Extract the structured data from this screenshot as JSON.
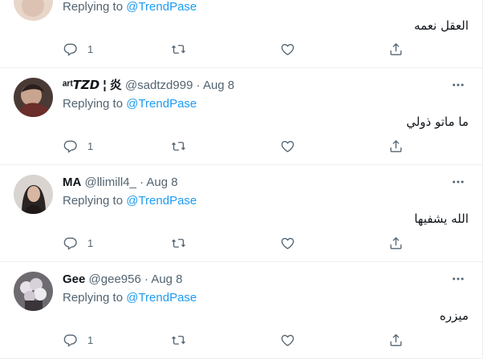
{
  "tweets": [
    {
      "name": "",
      "handle": "",
      "date": "",
      "replying_prefix": "Replying to",
      "replying_to": "@TrendPase",
      "text": "العقل نعمه",
      "reply_count": "1",
      "avatar_color": "#e8d6c9"
    },
    {
      "name": "ᵃʳᵗ𝙏𝙕𝘿 ¦ 炎",
      "handle": "@sadtzd999",
      "date": "Aug 8",
      "replying_prefix": "Replying to",
      "replying_to": "@TrendPase",
      "text": "ما ماتو ذولي",
      "reply_count": "1",
      "avatar_color": "#4a3a36"
    },
    {
      "name": "MA",
      "handle": "@llimill4_",
      "date": "Aug 8",
      "replying_prefix": "Replying to",
      "replying_to": "@TrendPase",
      "text": "الله يشفيها",
      "reply_count": "1",
      "avatar_color": "#2a2422"
    },
    {
      "name": "Gee",
      "handle": "@gee956",
      "date": "Aug 8",
      "replying_prefix": "Replying to",
      "replying_to": "@TrendPase",
      "text": "ميزره",
      "reply_count": "1",
      "avatar_color": "#c9c2c6"
    }
  ],
  "separator": "·",
  "icons": {
    "reply": "reply-icon",
    "retweet": "retweet-icon",
    "like": "like-icon",
    "share": "share-icon",
    "more": "more-icon"
  },
  "colors": {
    "accent": "#1d9bf0",
    "secondary_text": "#536471",
    "border": "#ebeef0"
  }
}
